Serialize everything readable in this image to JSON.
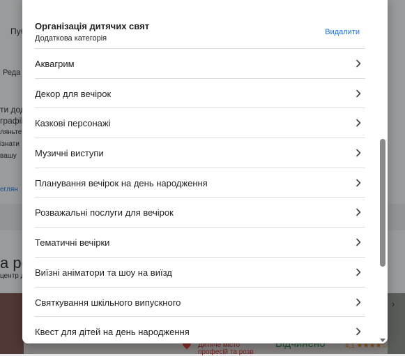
{
  "background": {
    "snippets": [
      {
        "text": "Пуб"
      },
      {
        "text": "Реда"
      },
      {
        "text": "ти дод"
      },
      {
        "text": "графії"
      },
      {
        "text": "ляньте"
      },
      {
        "text": "ізнати"
      },
      {
        "text": "вашу"
      },
      {
        "text": "еглян"
      },
      {
        "text": "а ро"
      },
      {
        "text": "центр д"
      },
      {
        "text": "Дитяче місто"
      },
      {
        "text": "професій та розв"
      },
      {
        "text": "Відчинено"
      },
      {
        "text": "4,1 ★★★★☆"
      }
    ]
  },
  "dialog": {
    "title": "Організація дитячих свят",
    "subtitle": "Додаткова категорія",
    "remove_label": "Видалити",
    "items": [
      {
        "label": "Аквагрим"
      },
      {
        "label": "Декор для вечірок"
      },
      {
        "label": "Казкові персонажі"
      },
      {
        "label": "Музичні виступи"
      },
      {
        "label": "Планування вечірок на день народження"
      },
      {
        "label": "Розважальні послуги для вечірок"
      },
      {
        "label": "Тематичні вечірки"
      },
      {
        "label": "Виїзні аніматори та шоу на виїзд"
      },
      {
        "label": "Святкування шкільного випускного"
      },
      {
        "label": "Квест для дітей на день народження"
      }
    ]
  },
  "icons": {
    "item_chevron": "chevron-right-icon",
    "scroll_down": "scroll-down-arrow-icon"
  },
  "colors": {
    "accent": "#1a73e8",
    "scrim": "#202124",
    "divider": "#dadce0"
  }
}
